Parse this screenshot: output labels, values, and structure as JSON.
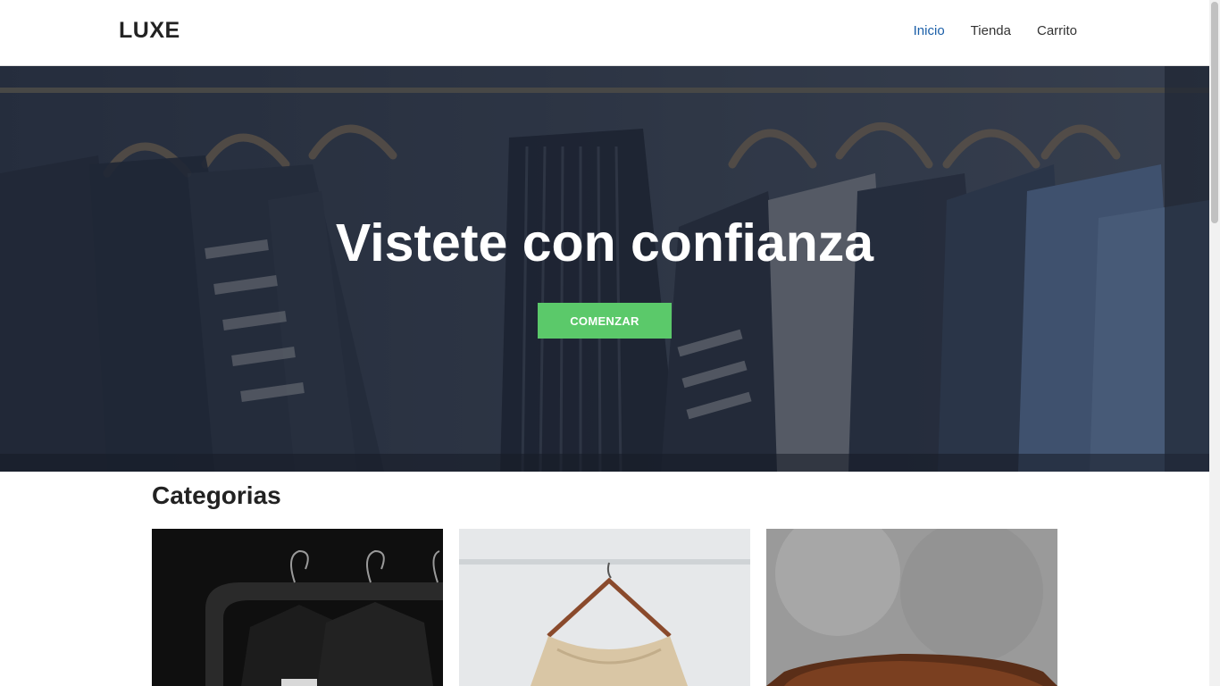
{
  "brand": {
    "logo": "LUXE"
  },
  "nav": {
    "items": [
      {
        "label": "Inicio",
        "active": true
      },
      {
        "label": "Tienda",
        "active": false
      },
      {
        "label": "Carrito",
        "active": false
      }
    ]
  },
  "hero": {
    "title": "Vistete con confianza",
    "cta_label": "COMENZAR"
  },
  "categories": {
    "title": "Categorias",
    "cards": [
      {
        "image": "black-shirts-on-hangers"
      },
      {
        "image": "knit-top-on-hanger"
      },
      {
        "image": "brown-leather-item"
      }
    ]
  },
  "colors": {
    "accent": "#5bc96a",
    "nav_active": "#1b5fa8",
    "hero_overlay": "#1e2533"
  }
}
